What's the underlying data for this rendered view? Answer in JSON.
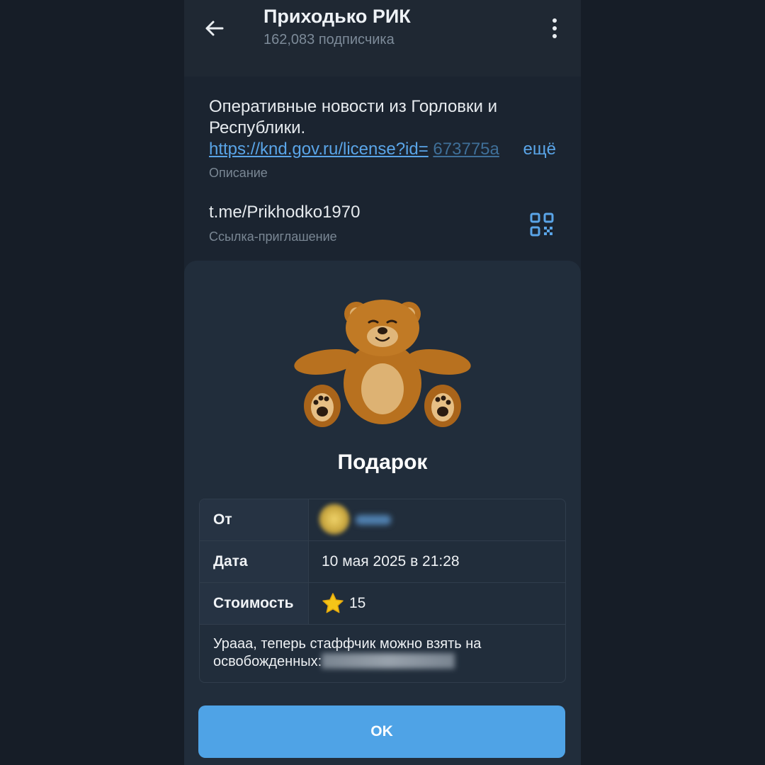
{
  "header": {
    "title": "Приходько РИК",
    "subtitle": "162,083 подписчика"
  },
  "description": {
    "text_line1": "Оперативные новости из Горловки и",
    "text_line2": "Республики.",
    "link": "https://knd.gov.ru/license?id=",
    "link_continuation": "673775a",
    "more": "ещё",
    "caption": "Описание"
  },
  "invite": {
    "link": "t.me/Prikhodko1970",
    "caption": "Ссылка-приглашение"
  },
  "gift": {
    "title": "Подарок",
    "rows": {
      "from_label": "От",
      "date_label": "Дата",
      "date_value": "10 мая 2025 в 21:28",
      "cost_label": "Стоимость",
      "cost_value": "15"
    },
    "message": "Урааа, теперь стаффчик можно взять на освобожденных:",
    "ok_label": "OK"
  },
  "colors": {
    "background": "#161d27",
    "accent": "#4fa3e6",
    "link": "#5aa5e8",
    "sheet": "#212d3b"
  },
  "icons": [
    "back-arrow-icon",
    "more-vert-icon",
    "qr-code-icon",
    "teddy-bear-icon",
    "star-icon"
  ]
}
